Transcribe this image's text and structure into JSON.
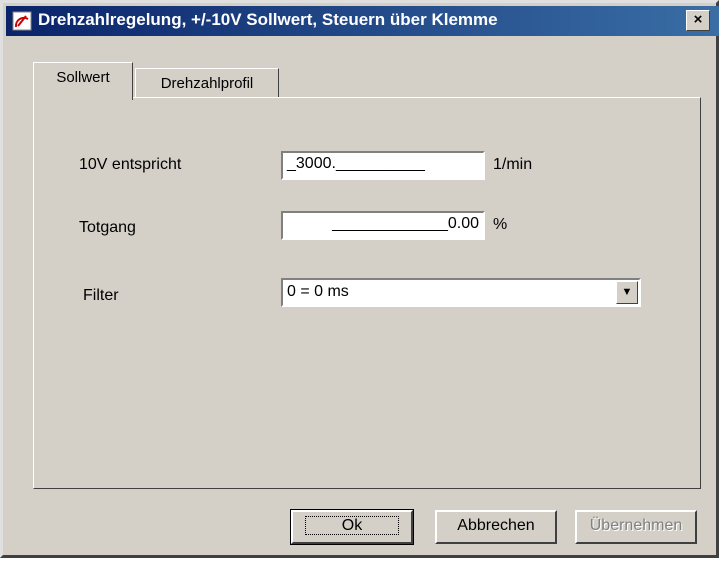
{
  "window": {
    "title": "Drehzahlregelung, +/-10V Sollwert, Steuern über Klemme",
    "close_label": "×"
  },
  "tabs": [
    {
      "label": "Sollwert",
      "active": true
    },
    {
      "label": "Drehzahlprofil",
      "active": false
    }
  ],
  "fields": {
    "volt_label": "10V entspricht",
    "volt_value": "_3000.__________",
    "volt_unit": "1/min",
    "totgang_label": "Totgang",
    "totgang_value": "_____________0.00",
    "totgang_unit": "%",
    "filter_label": "Filter",
    "filter_value": "0 = 0 ms"
  },
  "buttons": {
    "ok": "Ok",
    "cancel": "Abbrechen",
    "apply": "Übernehmen",
    "apply_enabled": false
  },
  "icons": {
    "app": "gauge-icon",
    "dropdown": "chevron-down-icon"
  }
}
